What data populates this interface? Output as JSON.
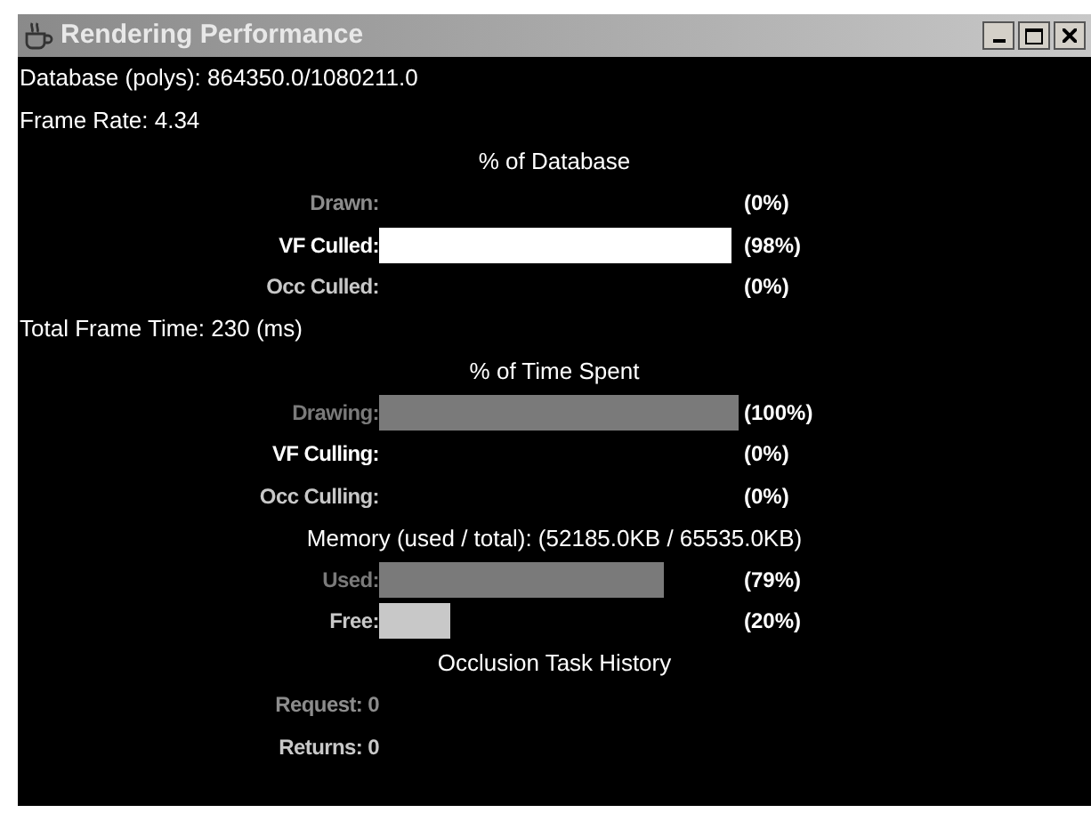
{
  "window": {
    "title": "Rendering Performance"
  },
  "stats": [
    "Database (polys): 864350.0/1080211.0",
    "Frame Rate: 4.34"
  ],
  "sections": [
    {
      "heading": "% of Database",
      "rows": [
        {
          "kind": "bar",
          "label": "Drawn:",
          "percent": "(0%)",
          "color": "#8c8c8c"
        },
        {
          "kind": "bar",
          "label": "VF Culled:",
          "percent": "(98%)",
          "color": "#ffffff"
        },
        {
          "kind": "bar",
          "label": "Occ Culled:",
          "percent": "(0%)",
          "color": "#c8c8c8"
        }
      ]
    },
    {
      "heading": "% of Time Spent",
      "before": "Total Frame Time: 230 (ms)",
      "rows": [
        {
          "kind": "bar",
          "label": "Drawing:",
          "percent": "(100%)",
          "color": "#7a7a7a"
        },
        {
          "kind": "bar",
          "label": "VF Culling:",
          "percent": "(0%)",
          "color": "#ffffff"
        },
        {
          "kind": "bar",
          "label": "Occ Culling:",
          "percent": "(0%)",
          "color": "#c8c8c8"
        }
      ]
    },
    {
      "heading": "Memory (used / total): (52185.0KB / 65535.0KB)",
      "rows": [
        {
          "kind": "bar",
          "label": "Used:",
          "percent": "(79%)",
          "color": "#7a7a7a"
        },
        {
          "kind": "bar",
          "label": "Free:",
          "percent": "(20%)",
          "color": "#c8c8c8"
        }
      ]
    },
    {
      "heading": "Occlusion Task History",
      "rows": [
        {
          "kind": "text",
          "label": "Request: 0",
          "color": "#8c8c8c"
        },
        {
          "kind": "text",
          "label": "Returns: 0",
          "color": "#c8c8c8"
        }
      ]
    }
  ]
}
